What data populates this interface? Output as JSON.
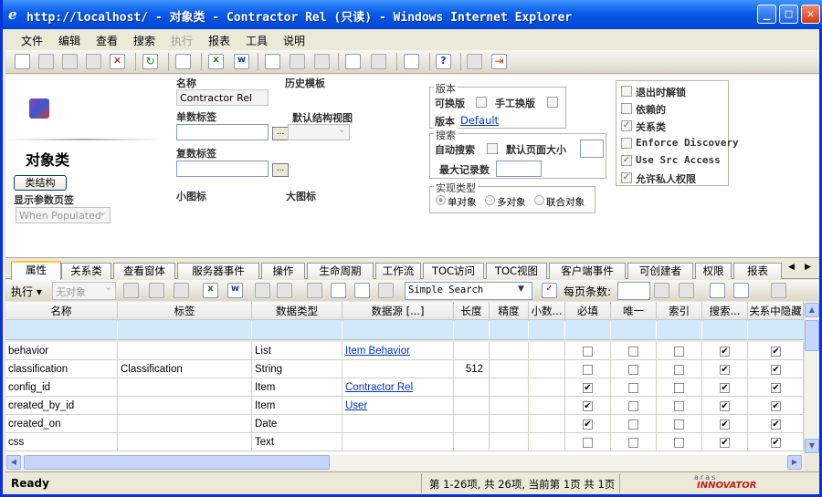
{
  "window": {
    "title": "http://localhost/ - 对象类 - Contractor Rel (只读) - Windows Internet Explorer",
    "min_label": "_",
    "max_label": "□",
    "close_label": "✕"
  },
  "menu": [
    "文件",
    "编辑",
    "查看",
    "搜索",
    "执行",
    "报表",
    "工具",
    "说明"
  ],
  "form": {
    "heading": "对象类",
    "class_structure_button": "类结构",
    "show_params_label": "显示参数页签",
    "show_params_value": "When Populated",
    "name_label": "名称",
    "name_value": "Contractor Rel",
    "history_template_label": "历史模板",
    "singular_label": "单数标签",
    "default_structure_view_label": "默认结构视图",
    "plural_label": "复数标签",
    "small_icon_label": "小图标",
    "large_icon_label": "大图标",
    "version_group": "版本",
    "versionable_label": "可换版",
    "manual_version_label": "手工换版",
    "version_label": "版本",
    "version_link": "Default",
    "search_group": "搜索",
    "auto_search_label": "自动搜索",
    "default_page_size_label": "默认页面大小",
    "max_records_label": "最大记录数",
    "impl_group": "实现类型",
    "impl_options": [
      "单对象",
      "多对象",
      "联合对象"
    ],
    "right_checks": [
      {
        "label": "退出时解锁",
        "checked": false
      },
      {
        "label": "依赖的",
        "checked": false
      },
      {
        "label": "关系类",
        "checked": true
      },
      {
        "label": "Enforce Discovery",
        "checked": false
      },
      {
        "label": "Use Src Access",
        "checked": true
      },
      {
        "label": "允许私人权限",
        "checked": true
      }
    ]
  },
  "tabs": [
    "属性",
    "关系类",
    "查看窗体",
    "服务器事件",
    "操作",
    "生命周期",
    "工作流",
    "TOC访问",
    "TOC视图",
    "客户端事件",
    "可创建者",
    "权限",
    "报表"
  ],
  "grid_toolbar": {
    "execute_label": "执行",
    "no_object_label": "无对象",
    "search_mode": "Simple Search",
    "page_items_label": "每页条数:"
  },
  "columns": [
    "名称",
    "标签",
    "数据类型",
    "数据源 [...]",
    "长度",
    "精度",
    "小数...",
    "必填",
    "唯一",
    "索引",
    "搜索...",
    "关系中隐藏"
  ],
  "rows": [
    {
      "name": "behavior",
      "label": "",
      "type": "List",
      "source": "Item Behavior",
      "length": "",
      "req": false,
      "uniq": false,
      "idx": false,
      "search": true,
      "hide": true
    },
    {
      "name": "classification",
      "label": "Classification",
      "type": "String",
      "source": "",
      "length": "512",
      "req": false,
      "uniq": false,
      "idx": false,
      "search": true,
      "hide": true
    },
    {
      "name": "config_id",
      "label": "",
      "type": "Item",
      "source": "Contractor Rel",
      "length": "",
      "req": true,
      "uniq": false,
      "idx": false,
      "search": true,
      "hide": true
    },
    {
      "name": "created_by_id",
      "label": "",
      "type": "Item",
      "source": "User",
      "length": "",
      "req": true,
      "uniq": false,
      "idx": false,
      "search": true,
      "hide": true
    },
    {
      "name": "created_on",
      "label": "",
      "type": "Date",
      "source": "",
      "length": "",
      "req": true,
      "uniq": false,
      "idx": false,
      "search": true,
      "hide": true
    },
    {
      "name": "css",
      "label": "",
      "type": "Text",
      "source": "",
      "length": "",
      "req": false,
      "uniq": false,
      "idx": false,
      "search": true,
      "hide": true
    }
  ],
  "status": {
    "ready": "Ready",
    "paging": "第 1-26项, 共 26项, 当前第 1页 共 1页",
    "brand_top": "aras",
    "brand_bottom": "INNOVATOR"
  },
  "colors": {
    "title_bar": "#0a5ae8",
    "filter_row": "#d4e8fb",
    "active_tab_accent": "#ffc83c"
  }
}
